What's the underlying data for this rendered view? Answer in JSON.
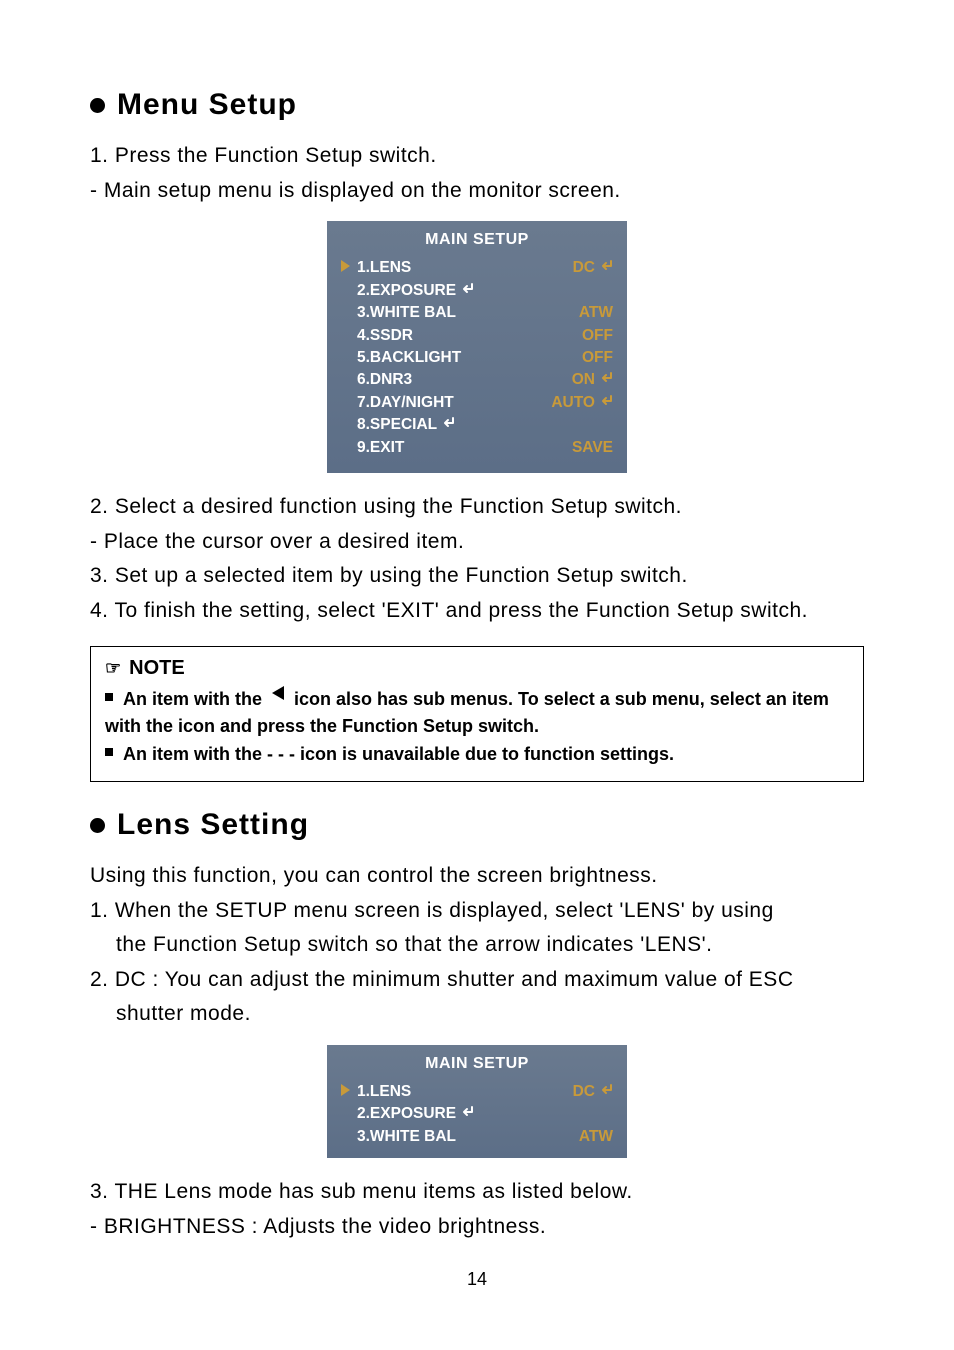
{
  "page_number": "14",
  "section1": {
    "heading": "Menu Setup",
    "p1": "1. Press the Function Setup switch.",
    "p2": "- Main setup menu is displayed on the monitor screen."
  },
  "menu1": {
    "title": "MAIN SETUP",
    "rows": [
      {
        "selected": true,
        "label": "1.LENS",
        "label_enter": false,
        "value": "DC",
        "value_enter": true
      },
      {
        "selected": false,
        "label": "2.EXPOSURE",
        "label_enter": true,
        "value": "",
        "value_enter": false
      },
      {
        "selected": false,
        "label": "3.WHITE BAL",
        "label_enter": false,
        "value": "ATW",
        "value_enter": false
      },
      {
        "selected": false,
        "label": "4.SSDR",
        "label_enter": false,
        "value": "OFF",
        "value_enter": false
      },
      {
        "selected": false,
        "label": "5.BACKLIGHT",
        "label_enter": false,
        "value": "OFF",
        "value_enter": false
      },
      {
        "selected": false,
        "label": "6.DNR3",
        "label_enter": false,
        "value": "ON",
        "value_enter": true
      },
      {
        "selected": false,
        "label": "7.DAY/NIGHT",
        "label_enter": false,
        "value": "AUTO",
        "value_enter": true
      },
      {
        "selected": false,
        "label": "8.SPECIAL",
        "label_enter": true,
        "value": "",
        "value_enter": false
      },
      {
        "selected": false,
        "label": "9.EXIT",
        "label_enter": false,
        "value": "SAVE",
        "value_enter": false
      }
    ]
  },
  "middle": {
    "p1": "2. Select a desired function using the Function Setup switch.",
    "p2": "- Place the cursor over a desired item.",
    "p3": "3. Set up a selected item by using the Function Setup switch.",
    "p4": "4. To finish the setting, select 'EXIT' and press the Function Setup switch."
  },
  "note": {
    "heading": "NOTE",
    "line1a": "An item with the",
    "line1b": "icon also has sub menus. To select a sub menu, select an item",
    "line1c": "with the icon and press the Function Setup switch.",
    "line2": "An item with the - - - icon is unavailable due to function settings."
  },
  "section2": {
    "heading": "Lens Setting",
    "intro": "Using this function, you can control the screen brightness.",
    "p1a": "1. When the SETUP menu screen is displayed, select 'LENS' by using",
    "p1b": "the Function Setup switch so that the arrow indicates 'LENS'.",
    "p2a": "2. DC : You can adjust the minimum shutter and maximum value of ESC",
    "p2b": "shutter mode."
  },
  "menu2": {
    "title": "MAIN SETUP",
    "rows": [
      {
        "selected": true,
        "label": "1.LENS",
        "label_enter": false,
        "value": "DC",
        "value_enter": true
      },
      {
        "selected": false,
        "label": "2.EXPOSURE",
        "label_enter": true,
        "value": "",
        "value_enter": false
      },
      {
        "selected": false,
        "label": "3.WHITE BAL",
        "label_enter": false,
        "value": "ATW",
        "value_enter": false
      }
    ]
  },
  "bottom": {
    "p1": "3. THE Lens mode has sub menu items as listed below.",
    "p2": "- BRIGHTNESS : Adjusts the video brightness."
  }
}
